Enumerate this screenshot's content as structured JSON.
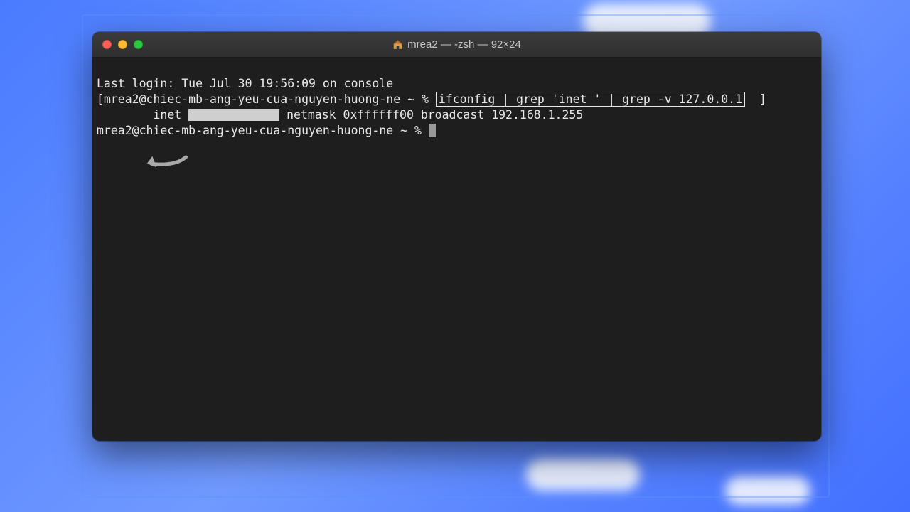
{
  "window": {
    "title_full": "mrea2 — -zsh — 92×24",
    "home_icon": "home-icon",
    "traffic": {
      "close": "close",
      "minimize": "minimize",
      "maximize": "maximize"
    }
  },
  "terminal": {
    "last_login": "Last login: Tue Jul 30 19:56:09 on console",
    "prompt1_open": "[",
    "prompt1_userhost": "mrea2@chiec-mb-ang-yeu-cua-nguyen-huong-ne ~ %",
    "command": "ifconfig | grep 'inet ' | grep -v 127.0.0.1",
    "prompt1_close": "]",
    "output_prefix": "        inet ",
    "output_suffix": " netmask 0xffffff00 broadcast 192.168.1.255",
    "prompt2": "mrea2@chiec-mb-ang-yeu-cua-nguyen-huong-ne ~ % "
  }
}
